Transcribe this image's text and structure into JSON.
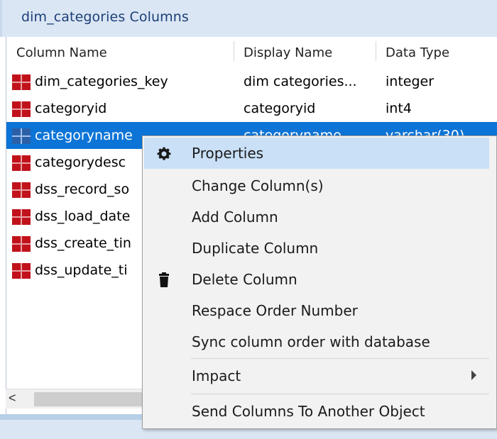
{
  "panel": {
    "title": "dim_categories Columns"
  },
  "columns": {
    "headers": [
      "Column Name",
      "Display Name",
      "Data Type"
    ]
  },
  "rows": [
    {
      "name": "dim_categories_key",
      "display": "dim categories...",
      "type": "integer",
      "selected": false
    },
    {
      "name": "categoryid",
      "display": "categoryid",
      "type": "int4",
      "selected": false
    },
    {
      "name": "categoryname",
      "display": "categoryname",
      "type": "varchar(30)",
      "selected": true
    },
    {
      "name": "categorydesc",
      "display": "",
      "type": "",
      "selected": false
    },
    {
      "name": "dss_record_so",
      "display": "",
      "type": "",
      "selected": false
    },
    {
      "name": "dss_load_date",
      "display": "",
      "type": "",
      "selected": false
    },
    {
      "name": "dss_create_tin",
      "display": "",
      "type": "",
      "selected": false
    },
    {
      "name": "dss_update_ti",
      "display": "",
      "type": "",
      "selected": false
    }
  ],
  "scrollbar": {
    "left_arrow": "<"
  },
  "context_menu": {
    "items": [
      {
        "label": "Properties",
        "icon": "gear-icon",
        "hover": true
      },
      {
        "label": "Change Column(s)",
        "icon": ""
      },
      {
        "label": "Add Column",
        "icon": ""
      },
      {
        "label": "Duplicate Column",
        "icon": ""
      },
      {
        "label": "Delete Column",
        "icon": "trash-icon"
      },
      {
        "label": "Respace Order Number",
        "icon": ""
      },
      {
        "label": "Sync column order with database",
        "icon": ""
      },
      {
        "label": "Impact",
        "icon": "",
        "submenu": true
      },
      {
        "label": "Send Columns To Another Object",
        "icon": ""
      }
    ]
  },
  "colors": {
    "selection": "#0c74d6",
    "menu_hover": "#c9e0f7",
    "column_icon_red": "#c1121c",
    "column_icon_selected": "#2b5fa8"
  }
}
